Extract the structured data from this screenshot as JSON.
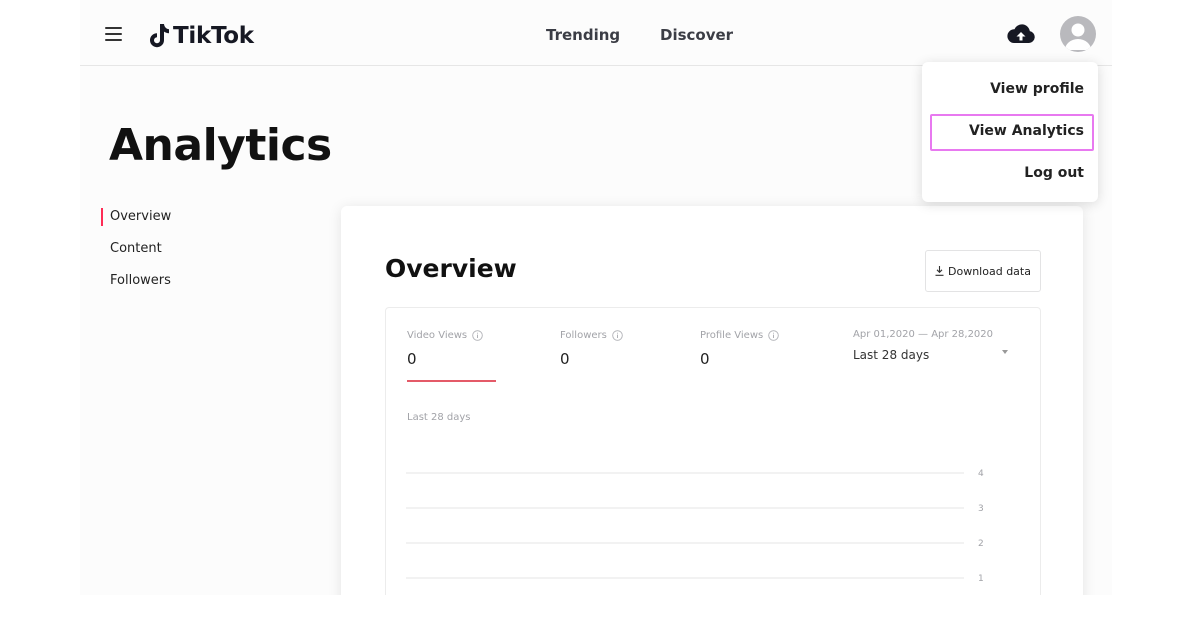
{
  "header": {
    "brand": "TikTok",
    "nav": [
      "Trending",
      "Discover"
    ]
  },
  "page": {
    "title": "Analytics"
  },
  "sidebar": {
    "items": [
      {
        "label": "Overview",
        "active": true
      },
      {
        "label": "Content",
        "active": false
      },
      {
        "label": "Followers",
        "active": false
      }
    ]
  },
  "overview": {
    "title": "Overview",
    "download_label": "Download data",
    "metrics": [
      {
        "label": "Video Views",
        "value": "0",
        "selected": true
      },
      {
        "label": "Followers",
        "value": "0",
        "selected": false
      },
      {
        "label": "Profile Views",
        "value": "0",
        "selected": false
      }
    ],
    "date_range": "Apr 01,2020 — Apr 28,2020",
    "range_select": "Last 28 days",
    "chart_caption": "Last 28 days"
  },
  "chart_data": {
    "type": "line",
    "y_ticks": [
      "4",
      "3",
      "2",
      "1"
    ],
    "ylim": [
      0,
      4
    ],
    "series": [],
    "grid": true
  },
  "menu": {
    "items": [
      "View profile",
      "View Analytics",
      "Log out"
    ],
    "highlighted": "View Analytics"
  },
  "colors": {
    "accent": "#fe2c55",
    "metric_underline": "#e45a68",
    "highlight_border": "#e879f0"
  }
}
